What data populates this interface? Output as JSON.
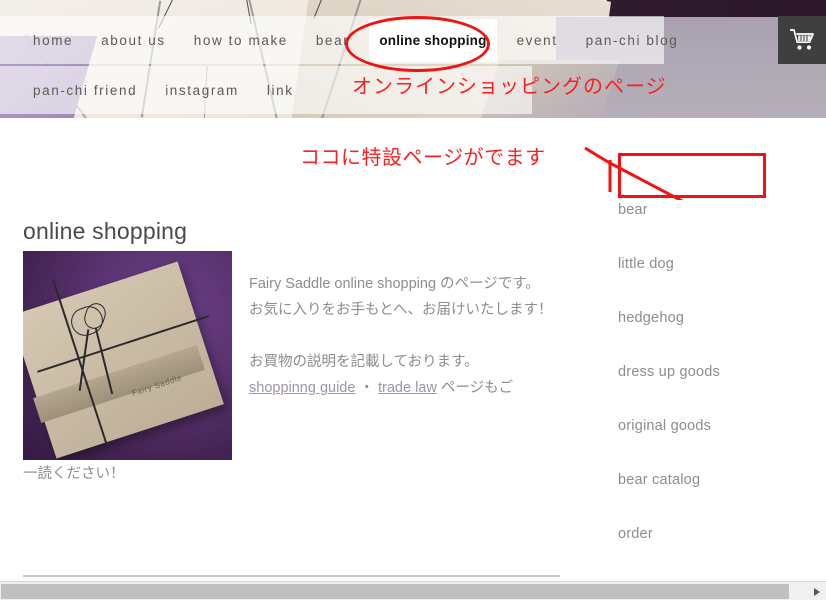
{
  "header": {
    "nav_row1": [
      {
        "label": "home",
        "active": false
      },
      {
        "label": "about us",
        "active": false
      },
      {
        "label": "how to make",
        "active": false
      },
      {
        "label": "bear",
        "active": false
      },
      {
        "label": "online shopping",
        "active": true
      },
      {
        "label": "event",
        "active": false
      },
      {
        "label": "pan-chi blog",
        "active": false
      }
    ],
    "nav_row2": [
      {
        "label": "pan-chi friend"
      },
      {
        "label": "instagram"
      },
      {
        "label": "link"
      }
    ],
    "cart_icon": "shopping-cart-icon",
    "annotation": "オンラインショッピングのページ"
  },
  "annotations": {
    "special_page": "ココに特設ページがでます",
    "marker_color": "#f81010"
  },
  "main": {
    "title": "online shopping",
    "image_caption": "Fairy Saddle",
    "paragraph1": "Fairy Saddle online shopping のページです。",
    "paragraph2": "お気に入りをお手もとへ、お届けいたします！",
    "paragraph3": "お買物の説明を記載しております。",
    "link_shopping_guide": "shoppinng guide",
    "link_separator": "・",
    "link_trade_law": "trade law",
    "after_links": "ページもご",
    "tail_line": "一読ください！",
    "link_color": "#9f93ad"
  },
  "sidebar": {
    "items": [
      {
        "label": "bear"
      },
      {
        "label": "little dog"
      },
      {
        "label": "hedgehog"
      },
      {
        "label": "dress up goods"
      },
      {
        "label": "original goods"
      },
      {
        "label": "bear catalog"
      },
      {
        "label": "order"
      }
    ]
  },
  "scrollbar": {
    "right_arrow_icon": "triangle-right-icon"
  }
}
